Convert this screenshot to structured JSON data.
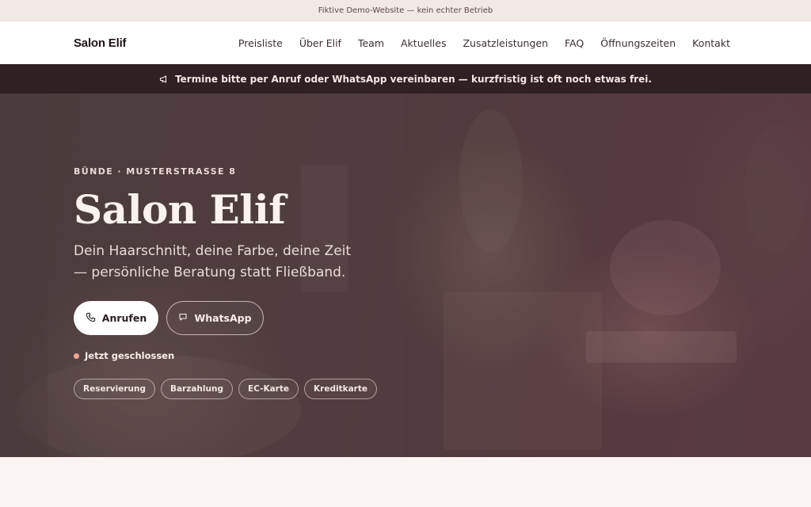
{
  "demo_bar": {
    "text": "Fiktive Demo-Website — kein echter Betrieb"
  },
  "navbar": {
    "brand": "Salon Elif",
    "items": [
      "Preisliste",
      "Über Elif",
      "Team",
      "Aktuelles",
      "Zusatzleistungen",
      "FAQ",
      "Öffnungszeiten",
      "Kontakt"
    ]
  },
  "announcement": {
    "text": "Termine bitte per Anruf oder WhatsApp vereinbaren — kurzfristig ist oft noch etwas frei.",
    "icon": "megaphone-icon"
  },
  "hero": {
    "kicker": "BÜNDE · MUSTERSTRASSE 8",
    "title": "Salon Elif",
    "subtitle": "Dein Haarschnitt, deine Farbe, deine Zeit — persönliche Beratung statt Fließband.",
    "call_label": "Anrufen",
    "whatsapp_label": "WhatsApp",
    "status_text": "Jetzt geschlossen",
    "status_color": "#f0a796",
    "chips": [
      "Reservierung",
      "Barzahlung",
      "EC-Karte",
      "Kreditkarte"
    ]
  },
  "colors": {
    "announce_bg": "#2e2023",
    "hero_bg": "#4f3c3e",
    "page_bg": "#faf5f2"
  }
}
